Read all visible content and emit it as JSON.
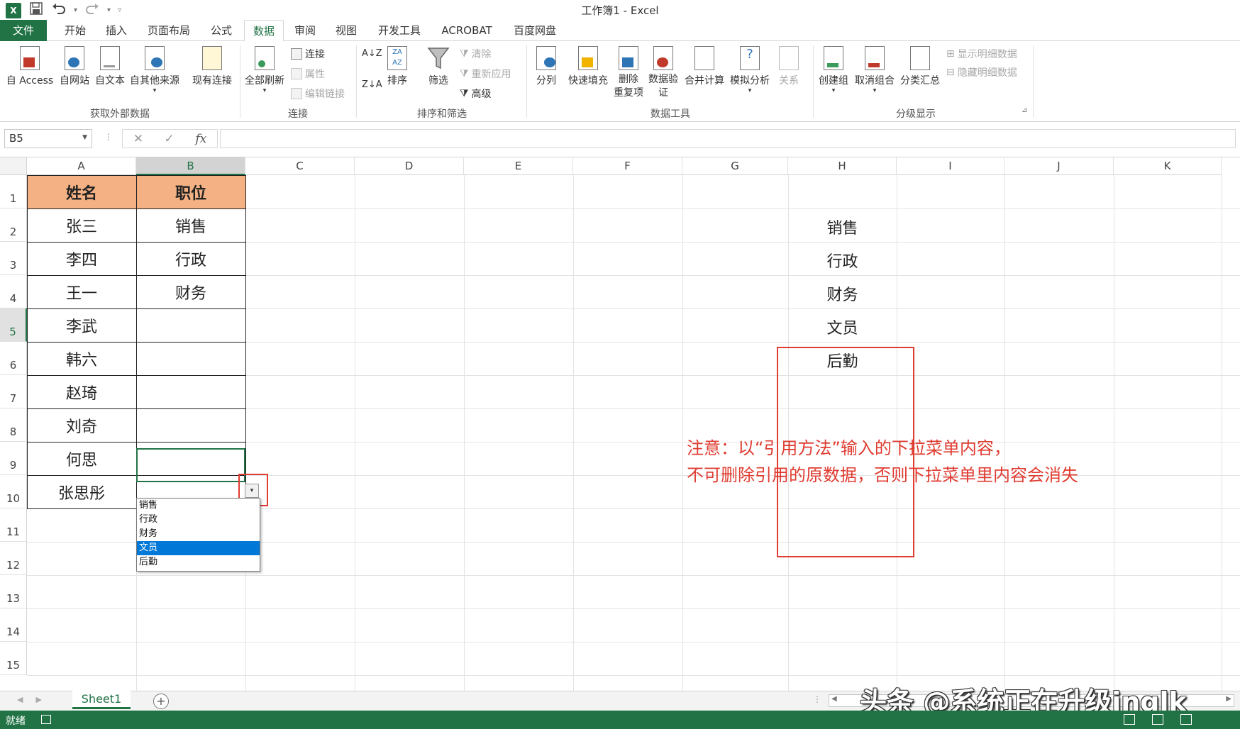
{
  "titlebar": {
    "title": "工作簿1 - Excel",
    "logo": "X",
    "save_icon": "floppy-disk",
    "undo_icon": "undo-arrow",
    "redo_icon": "redo-arrow"
  },
  "menu": {
    "tabs": [
      "文件",
      "开始",
      "插入",
      "页面布局",
      "公式",
      "数据",
      "审阅",
      "视图",
      "开发工具",
      "ACROBAT",
      "百度网盘"
    ],
    "active": "数据"
  },
  "ribbon": {
    "get_external": {
      "buttons": [
        "自 Access",
        "自网站",
        "自文本",
        "自其他来源",
        "现有连接"
      ],
      "label": "获取外部数据"
    },
    "connections": {
      "big": "全部刷新",
      "small": [
        "连接",
        "属性",
        "编辑链接"
      ],
      "label": "连接"
    },
    "sort_filter": {
      "sort": "排序",
      "filter": "筛选",
      "small": [
        "清除",
        "重新应用",
        "高级"
      ],
      "label": "排序和筛选"
    },
    "data_tools": {
      "buttons": [
        "分列",
        "快速填充",
        "删除\n重复项",
        "数据验\n证",
        "合并计算",
        "模拟分析",
        "关系"
      ],
      "label": "数据工具"
    },
    "outline": {
      "buttons": [
        "创建组",
        "取消组合",
        "分类汇总"
      ],
      "small": [
        "显示明细数据",
        "隐藏明细数据"
      ],
      "label": "分级显示"
    }
  },
  "formula_bar": {
    "name_box": "B5",
    "fx": "fx",
    "cancel": "✕",
    "enter": "✓",
    "value": ""
  },
  "sheet": {
    "columns": [
      "A",
      "B",
      "C",
      "D",
      "E",
      "F",
      "G",
      "H",
      "I",
      "J",
      "K"
    ],
    "rows": [
      "1",
      "2",
      "3",
      "4",
      "5",
      "6",
      "7",
      "8",
      "9",
      "10",
      "11",
      "12",
      "13",
      "14",
      "15"
    ],
    "selected_column": "B",
    "selected_row": "5",
    "table": {
      "headers": [
        "姓名",
        "职位"
      ],
      "names": [
        "张三",
        "李四",
        "王一",
        "李武",
        "韩六",
        "赵琦",
        "刘奇",
        "何思",
        "张思彤"
      ],
      "positions": [
        "销售",
        "行政",
        "财务",
        "",
        "",
        "",
        "",
        "",
        ""
      ]
    },
    "dropdown": {
      "options": [
        "销售",
        "行政",
        "财务",
        "文员",
        "后勤"
      ],
      "highlighted": "文员"
    },
    "source_list": [
      "销售",
      "行政",
      "财务",
      "文员",
      "后勤"
    ],
    "note_lines": [
      "注意：以“引用方法”输入的下拉菜单内容，",
      "不可删除引用的原数据，否则下拉菜单里内容会消失"
    ],
    "highlight_color": "#e03c31",
    "header_fill": "#f4b183"
  },
  "sheet_tabs": {
    "active": "Sheet1",
    "add": "+"
  },
  "watermark": "头条 @系统正在升级inglk",
  "status": {
    "text": "就绪"
  },
  "theme": {
    "accent": "#217346",
    "selection": "#0078d7"
  }
}
